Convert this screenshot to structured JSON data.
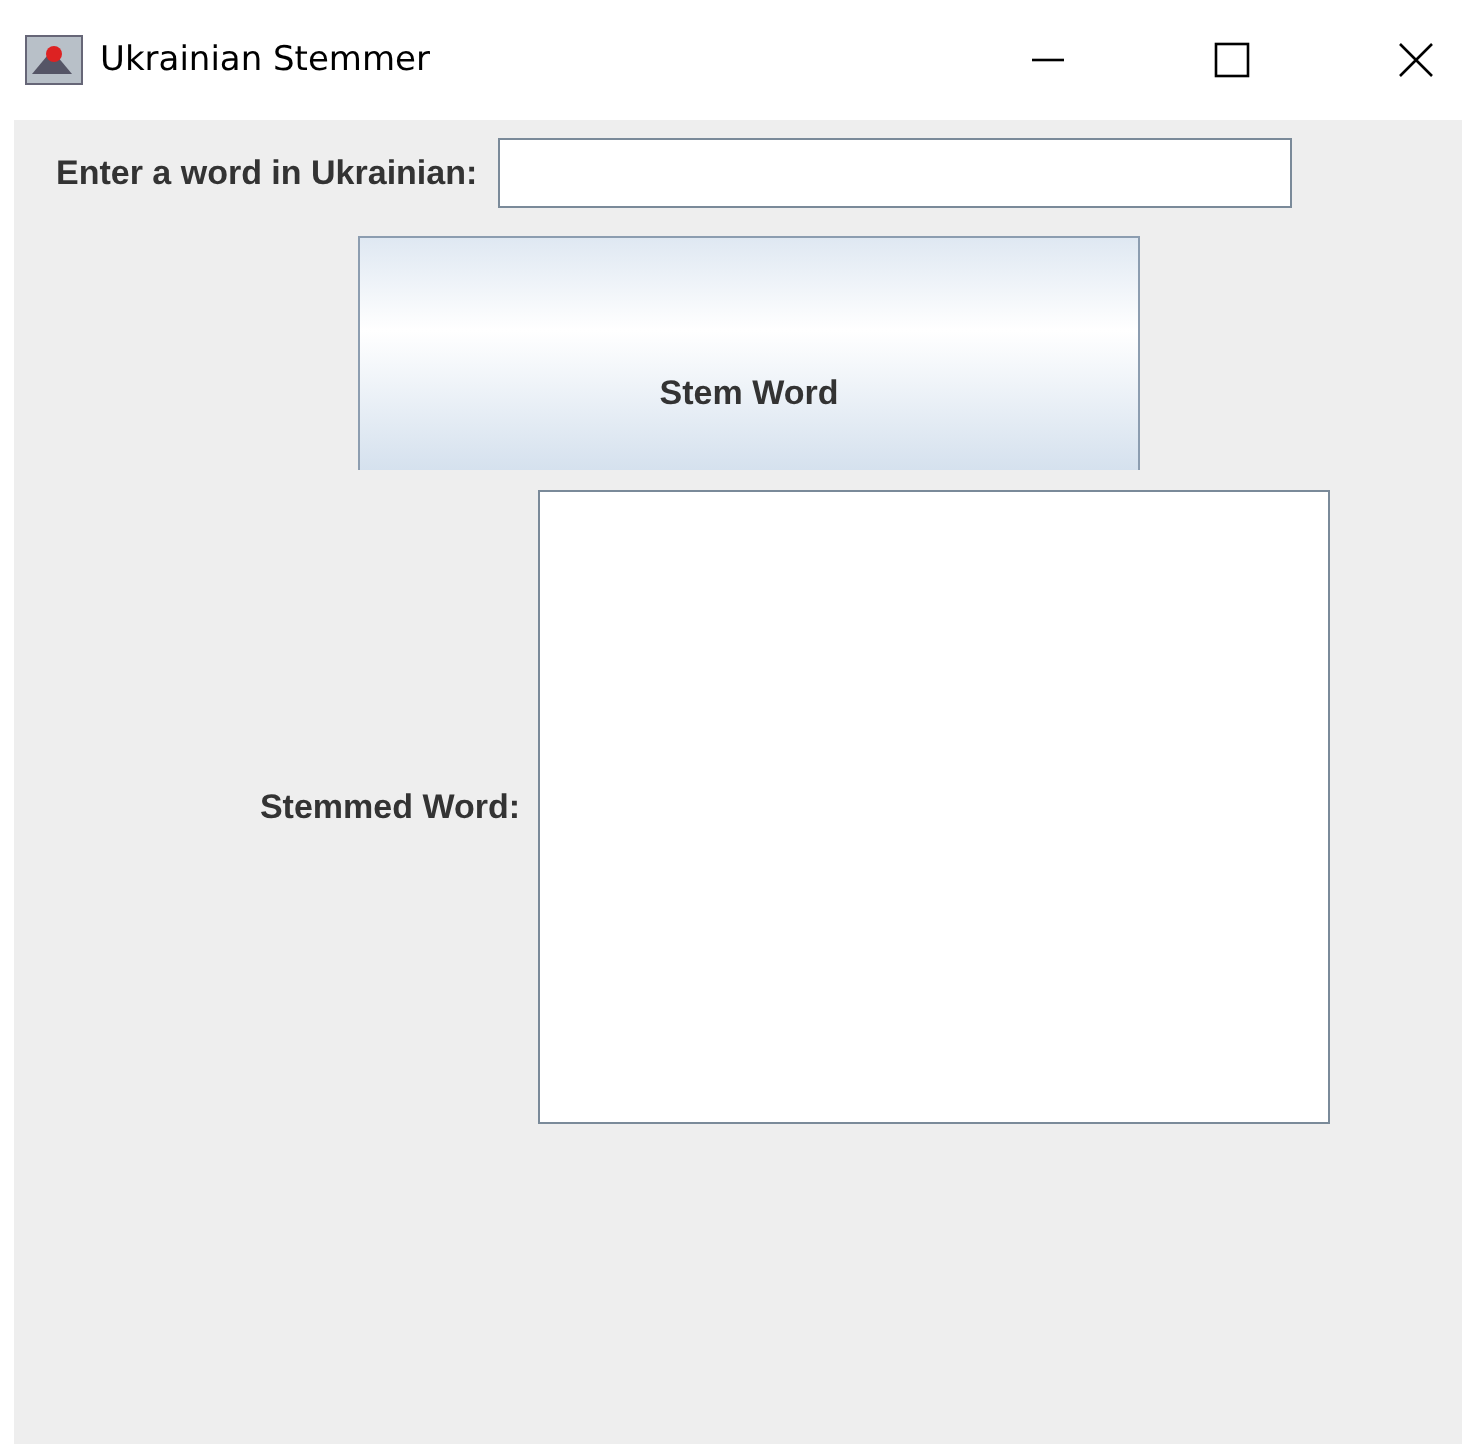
{
  "window": {
    "title": "Ukrainian Stemmer"
  },
  "input": {
    "label": "Enter a word in Ukrainian:"
  },
  "button": {
    "label": "Stem Word"
  },
  "output": {
    "label": "Stemmed Word:"
  }
}
